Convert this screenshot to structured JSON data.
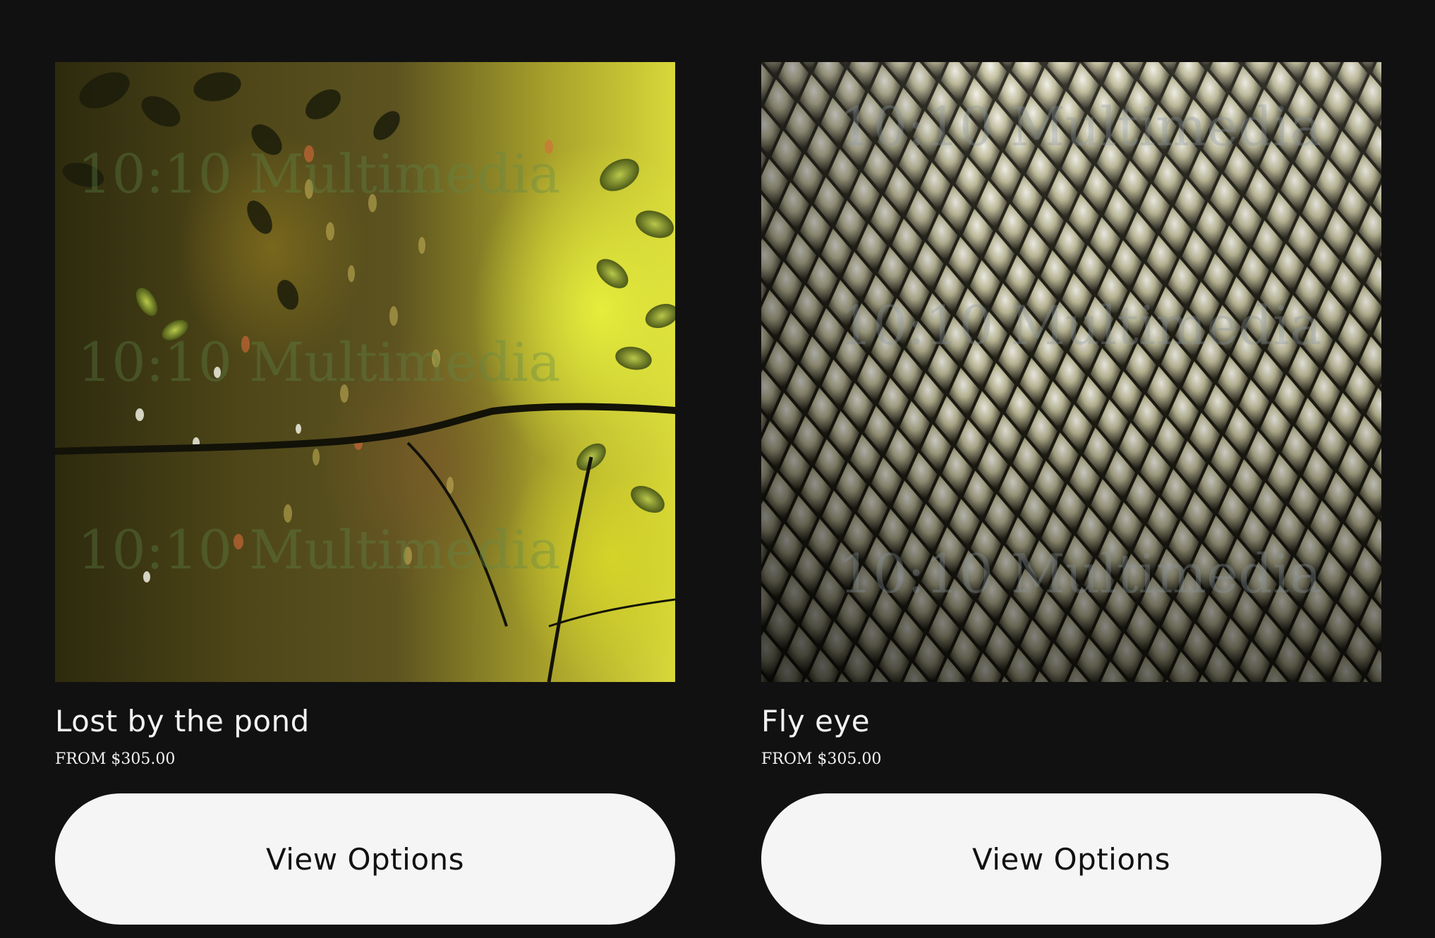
{
  "products": [
    {
      "title": "Lost by the pond",
      "price": "FROM $305.00",
      "button_label": "View Options",
      "watermark": "10:10 Multimedia",
      "palette": {
        "bright": "#d8d83a",
        "mid": "#6b5e22",
        "dark": "#1e1c0a"
      }
    },
    {
      "title": "Fly eye",
      "price": "FROM $305.00",
      "button_label": "View Options",
      "watermark": "10:10 Multimedia",
      "palette": {
        "light": "#e2e2da",
        "mid": "#a8a57e",
        "dark": "#1c1b12"
      }
    }
  ],
  "theme": {
    "background": "#111111",
    "text": "#f2f2f2",
    "button_bg": "#f5f5f5",
    "button_text": "#111111"
  }
}
